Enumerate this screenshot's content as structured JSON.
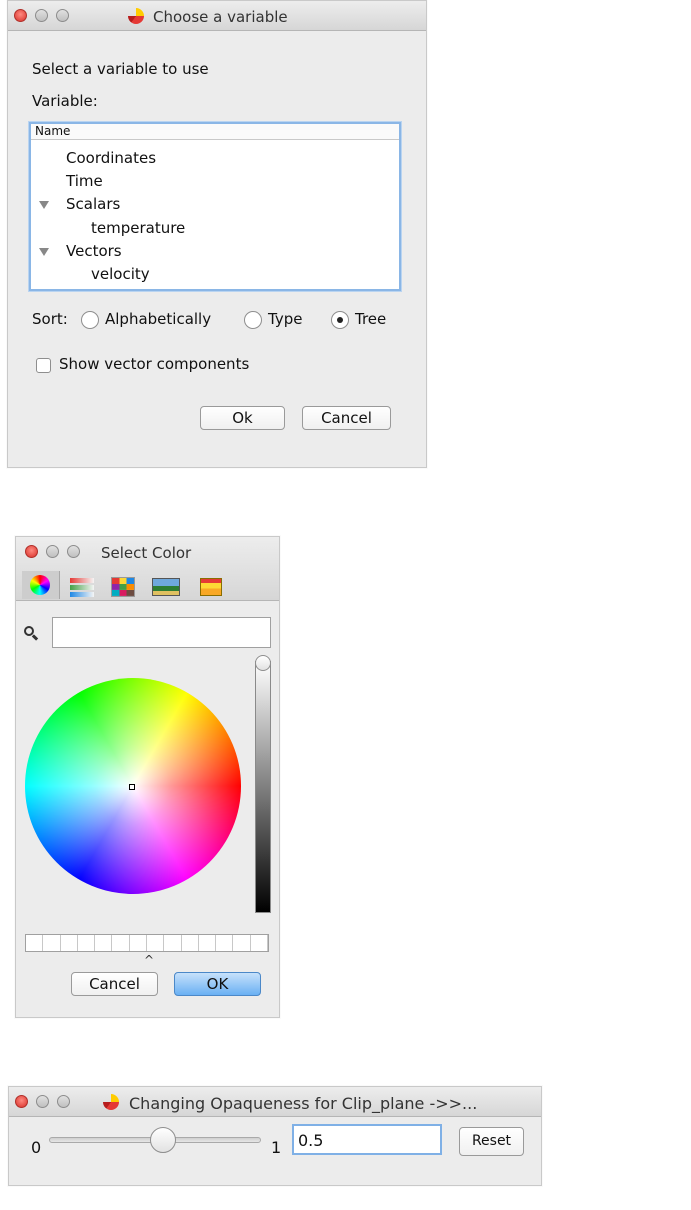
{
  "variable_dialog": {
    "title": "Choose a variable",
    "prompt": "Select a variable to use",
    "variable_label": "Variable:",
    "tree_header": "Name",
    "tree_items": [
      {
        "label": "Coordinates",
        "level": 0,
        "expandable": false
      },
      {
        "label": "Time",
        "level": 0,
        "expandable": false
      },
      {
        "label": "Scalars",
        "level": 0,
        "expandable": true
      },
      {
        "label": "temperature",
        "level": 1,
        "expandable": false
      },
      {
        "label": "Vectors",
        "level": 0,
        "expandable": true
      },
      {
        "label": "velocity",
        "level": 1,
        "expandable": false
      }
    ],
    "sort_label": "Sort:",
    "sort_options": [
      "Alphabetically",
      "Type",
      "Tree"
    ],
    "sort_selected": "Tree",
    "show_components_label": "Show vector components",
    "show_components_checked": false,
    "ok_label": "Ok",
    "cancel_label": "Cancel"
  },
  "color_dialog": {
    "title": "Select Color",
    "toolbar_icons": [
      "color-wheel-icon",
      "color-sliders-icon",
      "color-palettes-icon",
      "image-palettes-icon",
      "crayons-icon"
    ],
    "search_value": "",
    "cancel_label": "Cancel",
    "ok_label": "OK",
    "brightness_level": 1.0
  },
  "opacity_dialog": {
    "title": "Changing Opaqueness for Clip_plane ->>...",
    "min_label": "0",
    "max_label": "1",
    "slider_value": 0.5,
    "value_text": "0.5",
    "reset_label": "Reset"
  }
}
